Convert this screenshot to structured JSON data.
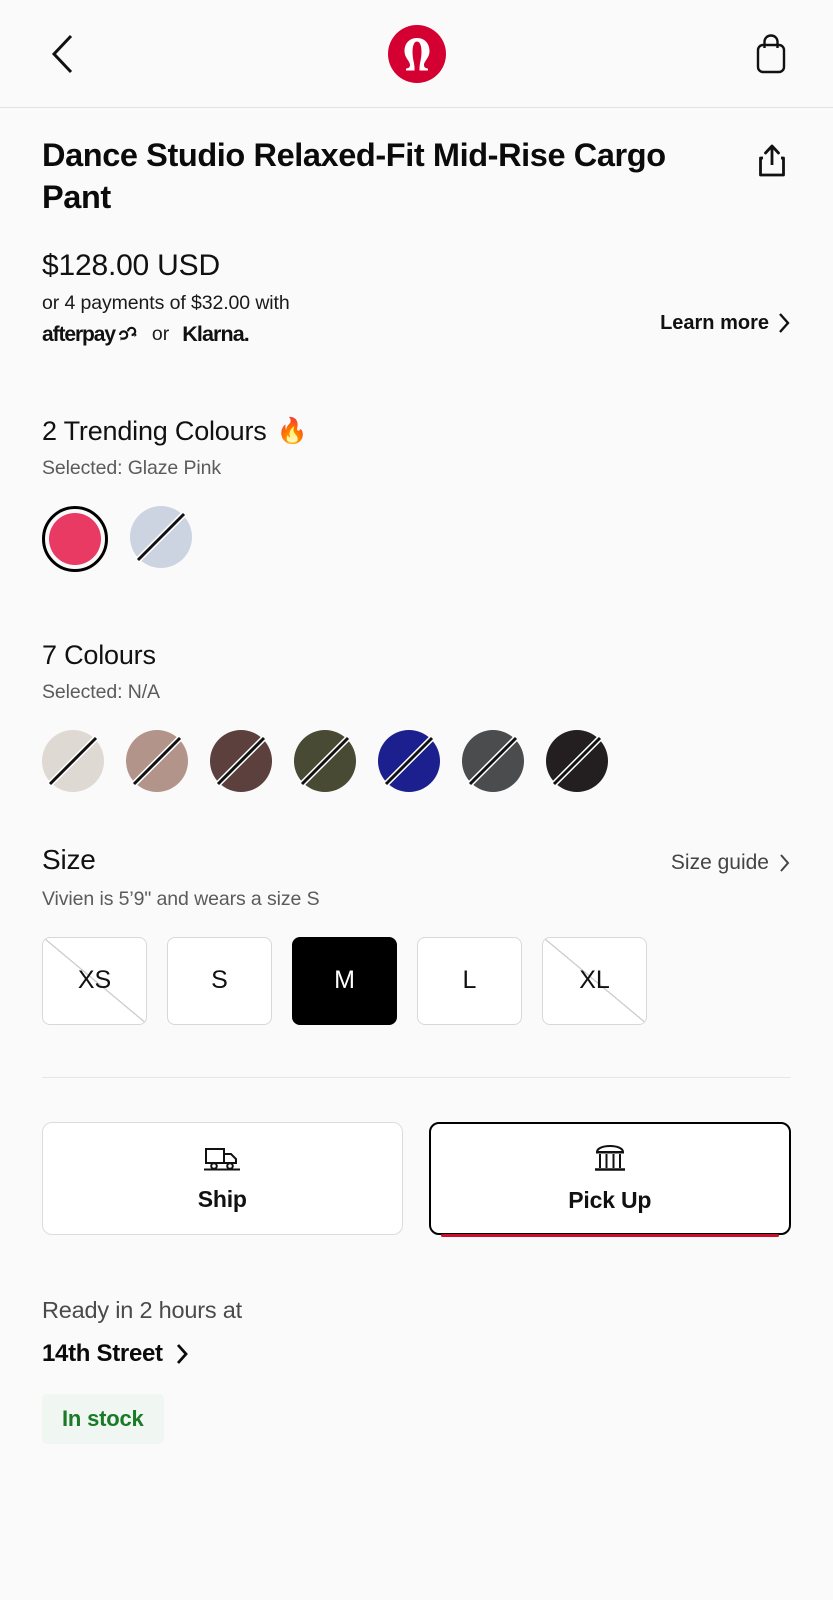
{
  "header": {
    "back_icon": "chevron-left-icon",
    "logo": "lululemon-logo",
    "logo_color": "#d50032",
    "bag_icon": "shopping-bag-icon"
  },
  "product": {
    "title": "Dance Studio Relaxed-Fit Mid-Rise Cargo Pant",
    "share_icon": "share-icon",
    "price": "$128.00 USD",
    "installments_text": "or 4 payments of $32.00 with",
    "afterpay_label": "afterpay",
    "or_label": "or",
    "klarna_label": "Klarna.",
    "learn_more_label": "Learn more"
  },
  "trending_colours": {
    "heading": "2 Trending Colours",
    "emoji": "🔥",
    "selected_label": "Selected: Glaze Pink",
    "swatches": [
      {
        "name": "Glaze Pink",
        "hex": "#e93a63",
        "selected": true,
        "unavailable": false
      },
      {
        "name": "Pale Blue Grey",
        "hex": "#ccd4e2",
        "selected": false,
        "unavailable": true
      }
    ]
  },
  "colours": {
    "heading": "7 Colours",
    "selected_label": "Selected: N/A",
    "swatches": [
      {
        "name": "Bone",
        "hex": "#ded9d2",
        "selected": false,
        "unavailable": true
      },
      {
        "name": "Taupe",
        "hex": "#b2948a",
        "selected": false,
        "unavailable": true
      },
      {
        "name": "Dark Brown",
        "hex": "#5b403d",
        "selected": false,
        "unavailable": true
      },
      {
        "name": "Olive Green",
        "hex": "#484a34",
        "selected": false,
        "unavailable": true
      },
      {
        "name": "Navy Blue",
        "hex": "#1c1f8e",
        "selected": false,
        "unavailable": true
      },
      {
        "name": "Graphite Grey",
        "hex": "#4a4c4d",
        "selected": false,
        "unavailable": true
      },
      {
        "name": "Black",
        "hex": "#231f20",
        "selected": false,
        "unavailable": true
      }
    ]
  },
  "size": {
    "title": "Size",
    "guide_label": "Size guide",
    "model_note": "Vivien is 5’9\" and wears a size S",
    "options": [
      {
        "label": "XS",
        "selected": false,
        "unavailable": true
      },
      {
        "label": "S",
        "selected": false,
        "unavailable": false
      },
      {
        "label": "M",
        "selected": true,
        "unavailable": false
      },
      {
        "label": "L",
        "selected": false,
        "unavailable": false
      },
      {
        "label": "XL",
        "selected": false,
        "unavailable": true
      }
    ]
  },
  "fulfilment": {
    "ship": {
      "label": "Ship",
      "icon": "delivery-truck-icon",
      "active": false
    },
    "pickup": {
      "label": "Pick Up",
      "icon": "store-icon",
      "active": true,
      "accent": "#c8102e"
    },
    "ready_text": "Ready in 2 hours at",
    "store_name": "14th Street",
    "stock_label": "In stock",
    "stock_color": "#1a7a28",
    "stock_bg": "#f0f6f1"
  }
}
